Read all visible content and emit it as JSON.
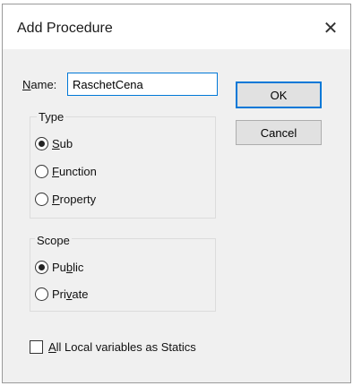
{
  "dialog": {
    "title": "Add Procedure",
    "close_glyph": "✕"
  },
  "name": {
    "label_accel": "N",
    "label_rest": "ame:",
    "value": "RaschetCena"
  },
  "buttons": {
    "ok": "OK",
    "cancel": "Cancel"
  },
  "type_group": {
    "label": "Type",
    "options": [
      {
        "pre": "",
        "accel": "S",
        "post": "ub",
        "selected": true
      },
      {
        "pre": "",
        "accel": "F",
        "post": "unction",
        "selected": false
      },
      {
        "pre": "",
        "accel": "P",
        "post": "roperty",
        "selected": false
      }
    ]
  },
  "scope_group": {
    "label": "Scope",
    "options": [
      {
        "pre": "Pu",
        "accel": "b",
        "post": "lic",
        "selected": true
      },
      {
        "pre": "Pri",
        "accel": "v",
        "post": "ate",
        "selected": false
      }
    ]
  },
  "statics": {
    "accel": "A",
    "rest": "ll Local variables as Statics",
    "checked": false
  }
}
